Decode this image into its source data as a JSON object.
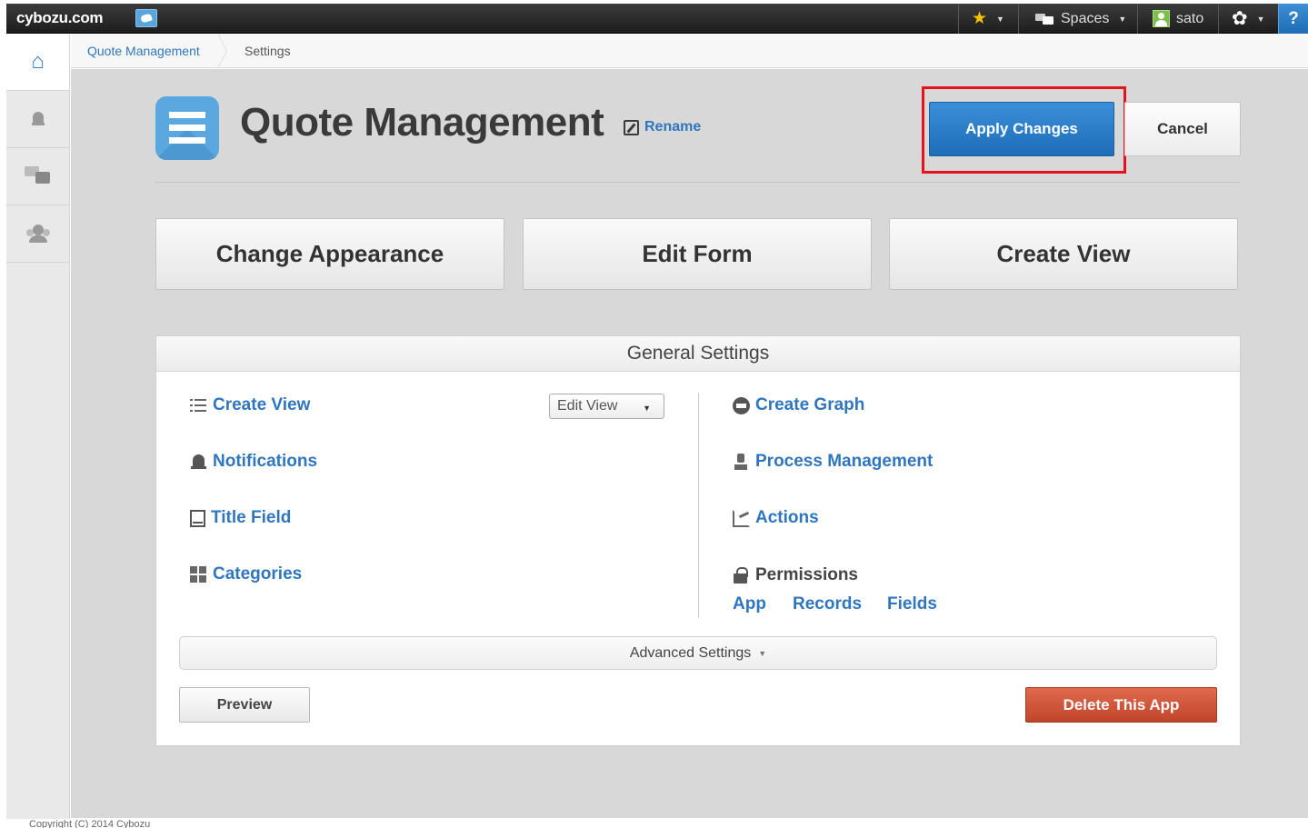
{
  "topbar": {
    "logo": "cybozu.com",
    "spaces_label": "Spaces",
    "user_name": "sato",
    "help_label": "?",
    "accent_color": "#2c7fd1"
  },
  "breadcrumb": {
    "items": [
      "Quote Management",
      "Settings"
    ]
  },
  "app": {
    "title": "Quote Management",
    "rename_label": "Rename",
    "apply_label": "Apply Changes",
    "cancel_label": "Cancel"
  },
  "actions": {
    "change_appearance": "Change Appearance",
    "edit_form": "Edit Form",
    "create_view": "Create View"
  },
  "general": {
    "heading": "General Settings",
    "left": {
      "create_view": "Create View",
      "notifications": "Notifications",
      "title_field": "Title Field",
      "categories": "Categories"
    },
    "edit_view_select": "Edit View",
    "right": {
      "create_graph": "Create Graph",
      "process_management": "Process Management",
      "actions": "Actions",
      "permissions": "Permissions"
    },
    "permission_links": [
      "App",
      "Records",
      "Fields"
    ],
    "advanced_label": "Advanced Settings",
    "preview_label": "Preview",
    "delete_label": "Delete This App",
    "delete_color": "#c9503a"
  },
  "footer": {
    "copyright": "Copyright (C) 2014 Cybozu"
  }
}
